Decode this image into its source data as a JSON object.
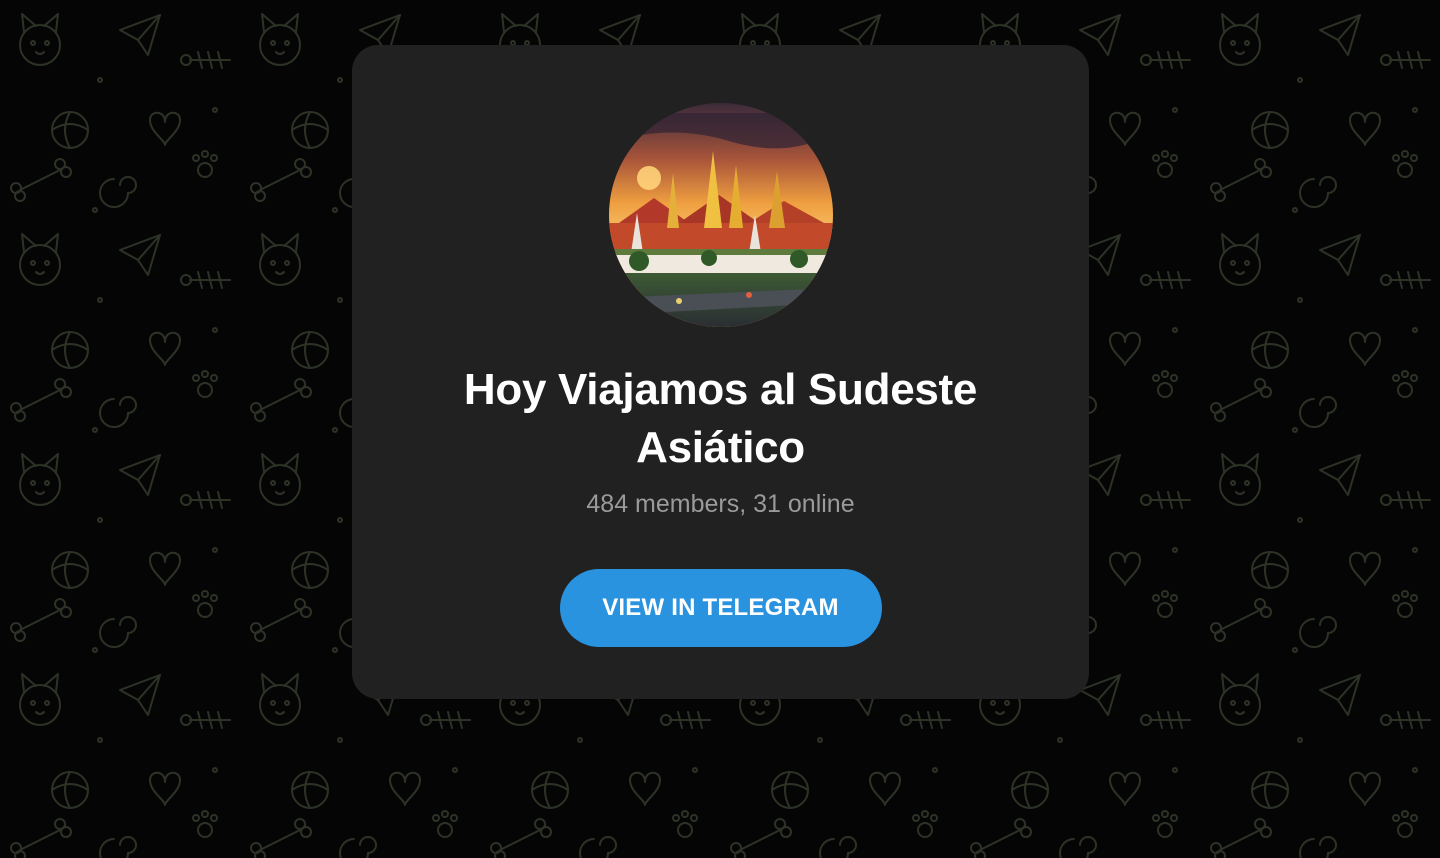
{
  "channel": {
    "title": "Hoy Viajamos al Sudeste Asiático",
    "subtitle": "484 members, 31 online",
    "avatar_icon": "temple-photo-icon"
  },
  "actions": {
    "view_button_label": "VIEW IN TELEGRAM"
  },
  "colors": {
    "page_background": "#000000",
    "doodle_stroke": "#2c3326",
    "card_background": "#212121",
    "button_background": "#2a93e0",
    "title_text": "#ffffff",
    "subtitle_text": "#9a9a9a"
  },
  "background": {
    "pattern_icon": "telegram-doodle-pattern"
  }
}
